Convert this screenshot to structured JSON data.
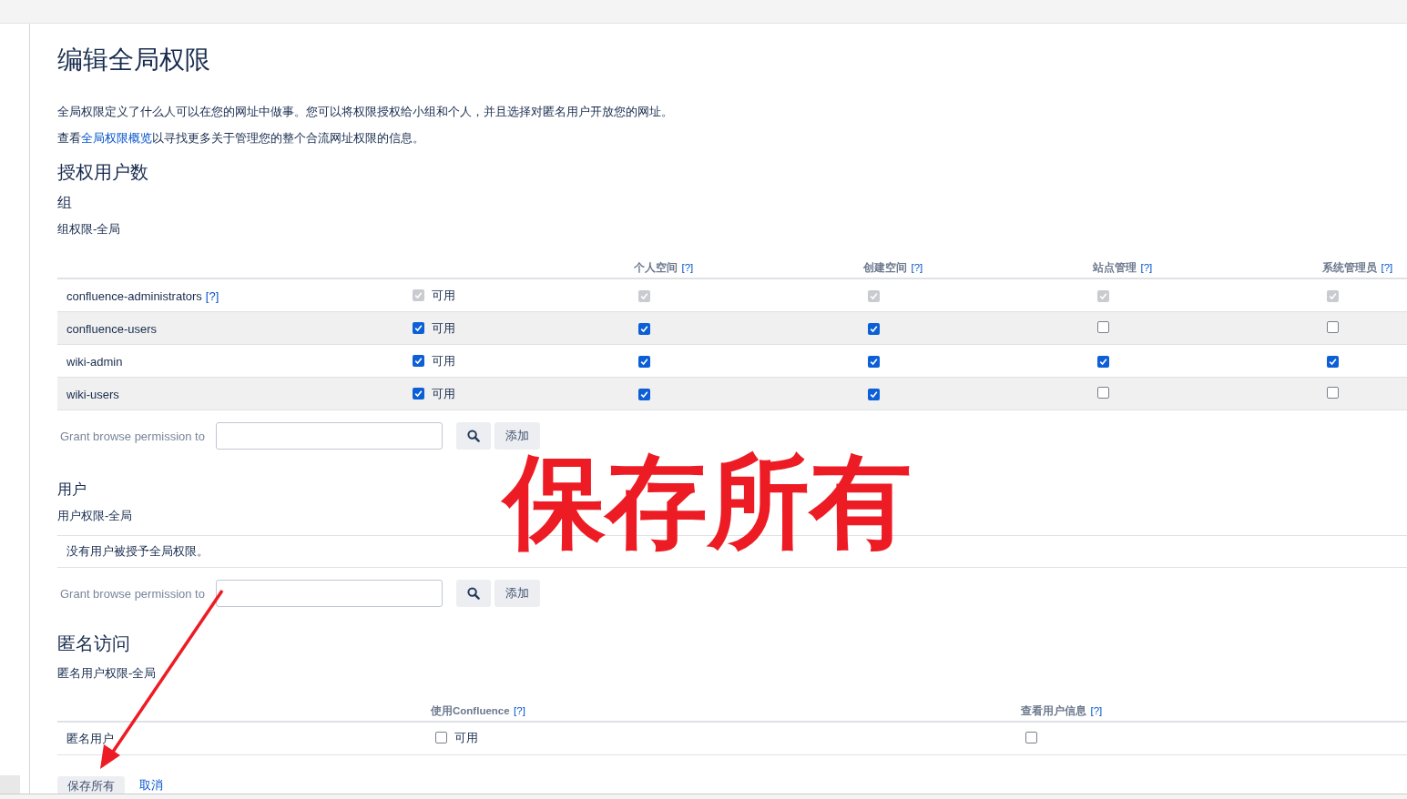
{
  "title": "编辑全局权限",
  "intro": "全局权限定义了什么人可以在您的网址中做事。您可以将权限授权给小组和个人，并且选择对匿名用户开放您的网址。",
  "overview": {
    "before": "查看",
    "link": "全局权限概览",
    "after": "以寻找更多关于管理您的整个合流网址权限的信息。"
  },
  "licensed_users": {
    "heading": "授权用户数"
  },
  "groups": {
    "heading": "组",
    "subheading": "组权限-全局",
    "table": {
      "columns": [
        {
          "label": "个人空间",
          "help": "[?]"
        },
        {
          "label": "创建空间",
          "help": "[?]"
        },
        {
          "label": "站点管理",
          "help": "[?]"
        },
        {
          "label": "系统管理员",
          "help": "[?]"
        }
      ],
      "rows": [
        {
          "name": "confluence-administrators",
          "help": "[?]",
          "cells": [
            {
              "label": "可用",
              "checked": true,
              "disabled": true
            },
            {
              "checked": true,
              "disabled": true
            },
            {
              "checked": true,
              "disabled": true
            },
            {
              "checked": true,
              "disabled": true
            },
            {
              "checked": true,
              "disabled": true
            }
          ]
        },
        {
          "name": "confluence-users",
          "cells": [
            {
              "label": "可用",
              "checked": true,
              "disabled": false
            },
            {
              "checked": true,
              "disabled": false
            },
            {
              "checked": true,
              "disabled": false
            },
            {
              "checked": false,
              "disabled": false
            },
            {
              "checked": false,
              "disabled": false
            }
          ]
        },
        {
          "name": "wiki-admin",
          "cells": [
            {
              "label": "可用",
              "checked": true,
              "disabled": false
            },
            {
              "checked": true,
              "disabled": false
            },
            {
              "checked": true,
              "disabled": false
            },
            {
              "checked": true,
              "disabled": false
            },
            {
              "checked": true,
              "disabled": false
            }
          ]
        },
        {
          "name": "wiki-users",
          "cells": [
            {
              "label": "可用",
              "checked": true,
              "disabled": false
            },
            {
              "checked": true,
              "disabled": false
            },
            {
              "checked": true,
              "disabled": false
            },
            {
              "checked": false,
              "disabled": false
            },
            {
              "checked": false,
              "disabled": false
            }
          ]
        }
      ]
    },
    "grant": {
      "label": "Grant browse permission to",
      "button": "添加"
    }
  },
  "users": {
    "heading": "用户",
    "subheading": "用户权限-全局",
    "empty": "没有用户被授予全局权限。",
    "grant": {
      "label": "Grant browse permission to",
      "button": "添加"
    }
  },
  "anonymous": {
    "heading": "匿名访问",
    "subheading": "匿名用户权限-全局",
    "table": {
      "columns": [
        {
          "label": "使用Confluence",
          "help": "[?]"
        },
        {
          "label": "查看用户信息",
          "help": "[?]"
        }
      ],
      "rows": [
        {
          "name": "匿名用户",
          "cells": [
            {
              "label": "可用",
              "checked": false,
              "disabled": false
            },
            {
              "checked": false,
              "disabled": false
            }
          ]
        }
      ]
    }
  },
  "actions": {
    "save": "保存所有",
    "cancel": "取消"
  },
  "annotation": {
    "text": "保存所有"
  }
}
